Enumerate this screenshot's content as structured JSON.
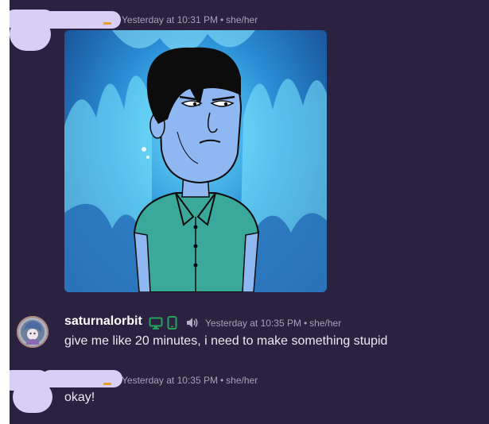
{
  "messages": [
    {
      "timestamp": "Yesterday at 10:31 PM",
      "pronouns": "she/her",
      "attachment_icon": "animated-gif-image"
    },
    {
      "username": "saturnalorbit",
      "status_icons": [
        "desktop-icon",
        "mobile-icon",
        "speaker-icon"
      ],
      "timestamp": "Yesterday at 10:35 PM",
      "pronouns": "she/her",
      "text": "give me like 20 minutes, i need to make something stupid"
    },
    {
      "timestamp": "Yesterday at 10:35 PM",
      "pronouns": "she/her",
      "text": "okay!"
    }
  ],
  "colors": {
    "background": "#2b2140",
    "redaction": "#d7cff5",
    "online_green": "#23a559",
    "meta_text": "#a7a1b6",
    "crown": "#e4a12a"
  }
}
